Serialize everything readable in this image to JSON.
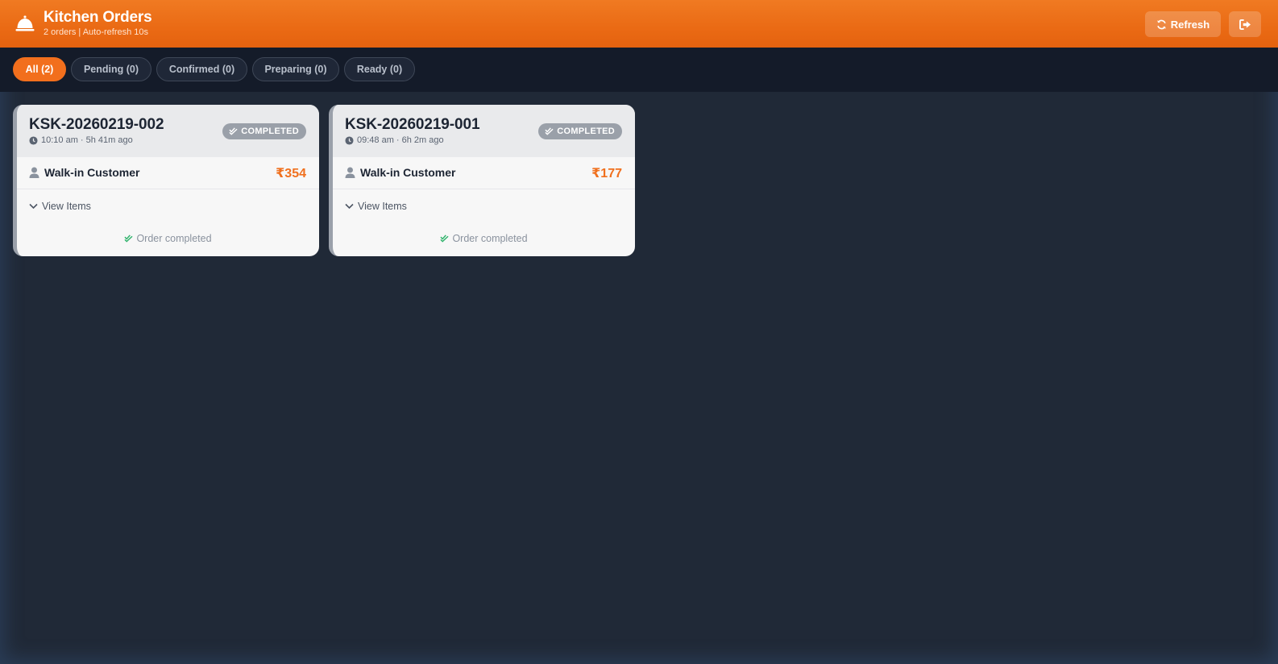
{
  "header": {
    "title": "Kitchen Orders",
    "subtitle": "2 orders | Auto-refresh 10s",
    "refresh_label": "Refresh",
    "icons": {
      "app": "bell-icon",
      "refresh": "refresh-icon",
      "logout": "logout-icon"
    }
  },
  "filters": [
    {
      "label": "All (2)",
      "active": true
    },
    {
      "label": "Pending (0)",
      "active": false
    },
    {
      "label": "Confirmed (0)",
      "active": false
    },
    {
      "label": "Preparing (0)",
      "active": false
    },
    {
      "label": "Ready (0)",
      "active": false
    }
  ],
  "orders": [
    {
      "id": "KSK-20260219-002",
      "time": "10:10 am · 5h 41m ago",
      "status": "COMPLETED",
      "customer": "Walk-in Customer",
      "amount": "₹354",
      "view_items_label": "View Items",
      "completed_label": "Order completed"
    },
    {
      "id": "KSK-20260219-001",
      "time": "09:48 am · 6h 2m ago",
      "status": "COMPLETED",
      "customer": "Walk-in Customer",
      "amount": "₹177",
      "view_items_label": "View Items",
      "completed_label": "Order completed"
    }
  ],
  "colors": {
    "accent": "#f26f1d",
    "header_bg": "#ea6a14",
    "page_bg": "#202937",
    "filter_bar_bg": "#141b29",
    "amount": "#f0701e",
    "status_badge": "#9aa0a9",
    "check_green": "#2fb36b"
  }
}
